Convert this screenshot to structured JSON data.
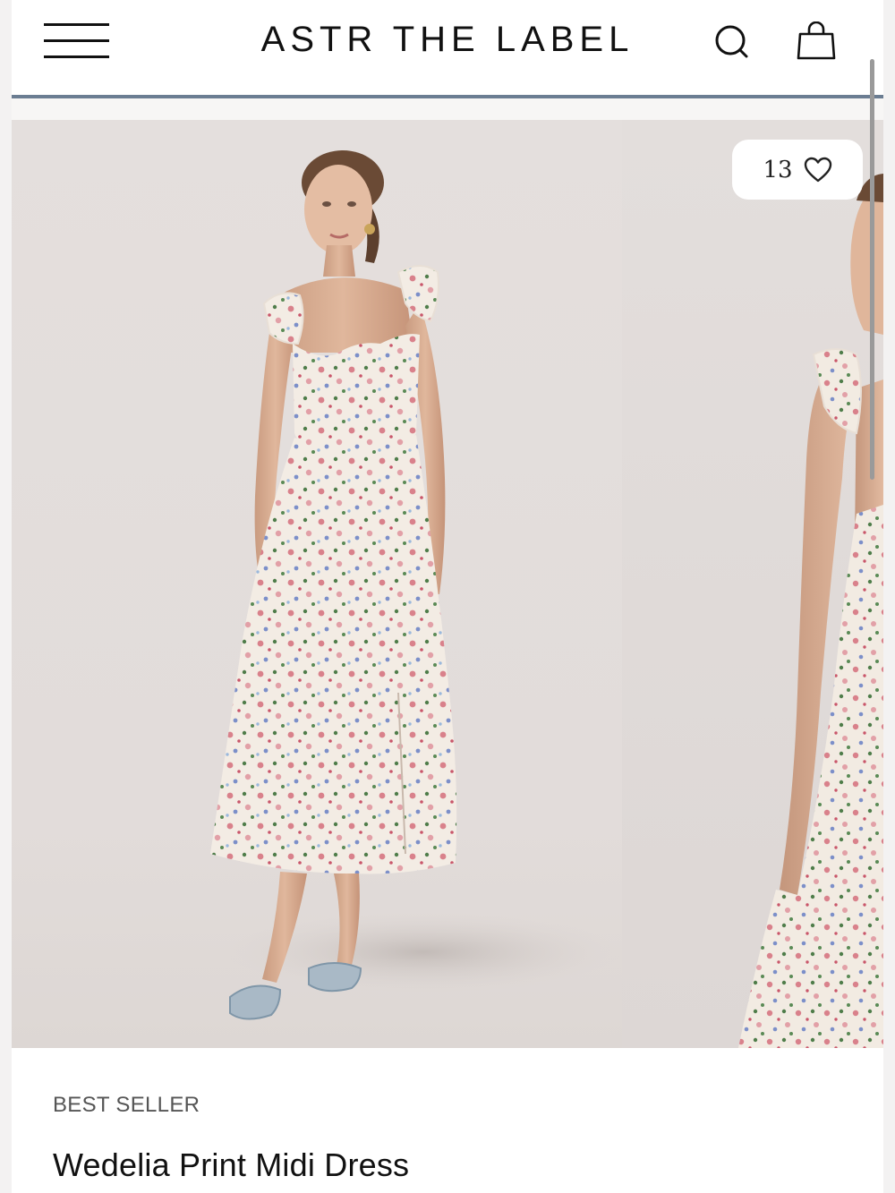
{
  "header": {
    "brand": "ASTR THE LABEL",
    "menu_icon": "hamburger-menu-icon",
    "search_icon": "search-icon",
    "bag_icon": "shopping-bag-icon"
  },
  "gallery": {
    "like_count": "13",
    "like_icon": "heart-outline-icon"
  },
  "product": {
    "badge": "BEST SELLER",
    "title": "Wedelia Print Midi Dress"
  },
  "colors": {
    "header_rule": "#6b7d92",
    "text_primary": "#111111",
    "text_secondary": "#555555",
    "photo_background": "#e4dfdd"
  }
}
